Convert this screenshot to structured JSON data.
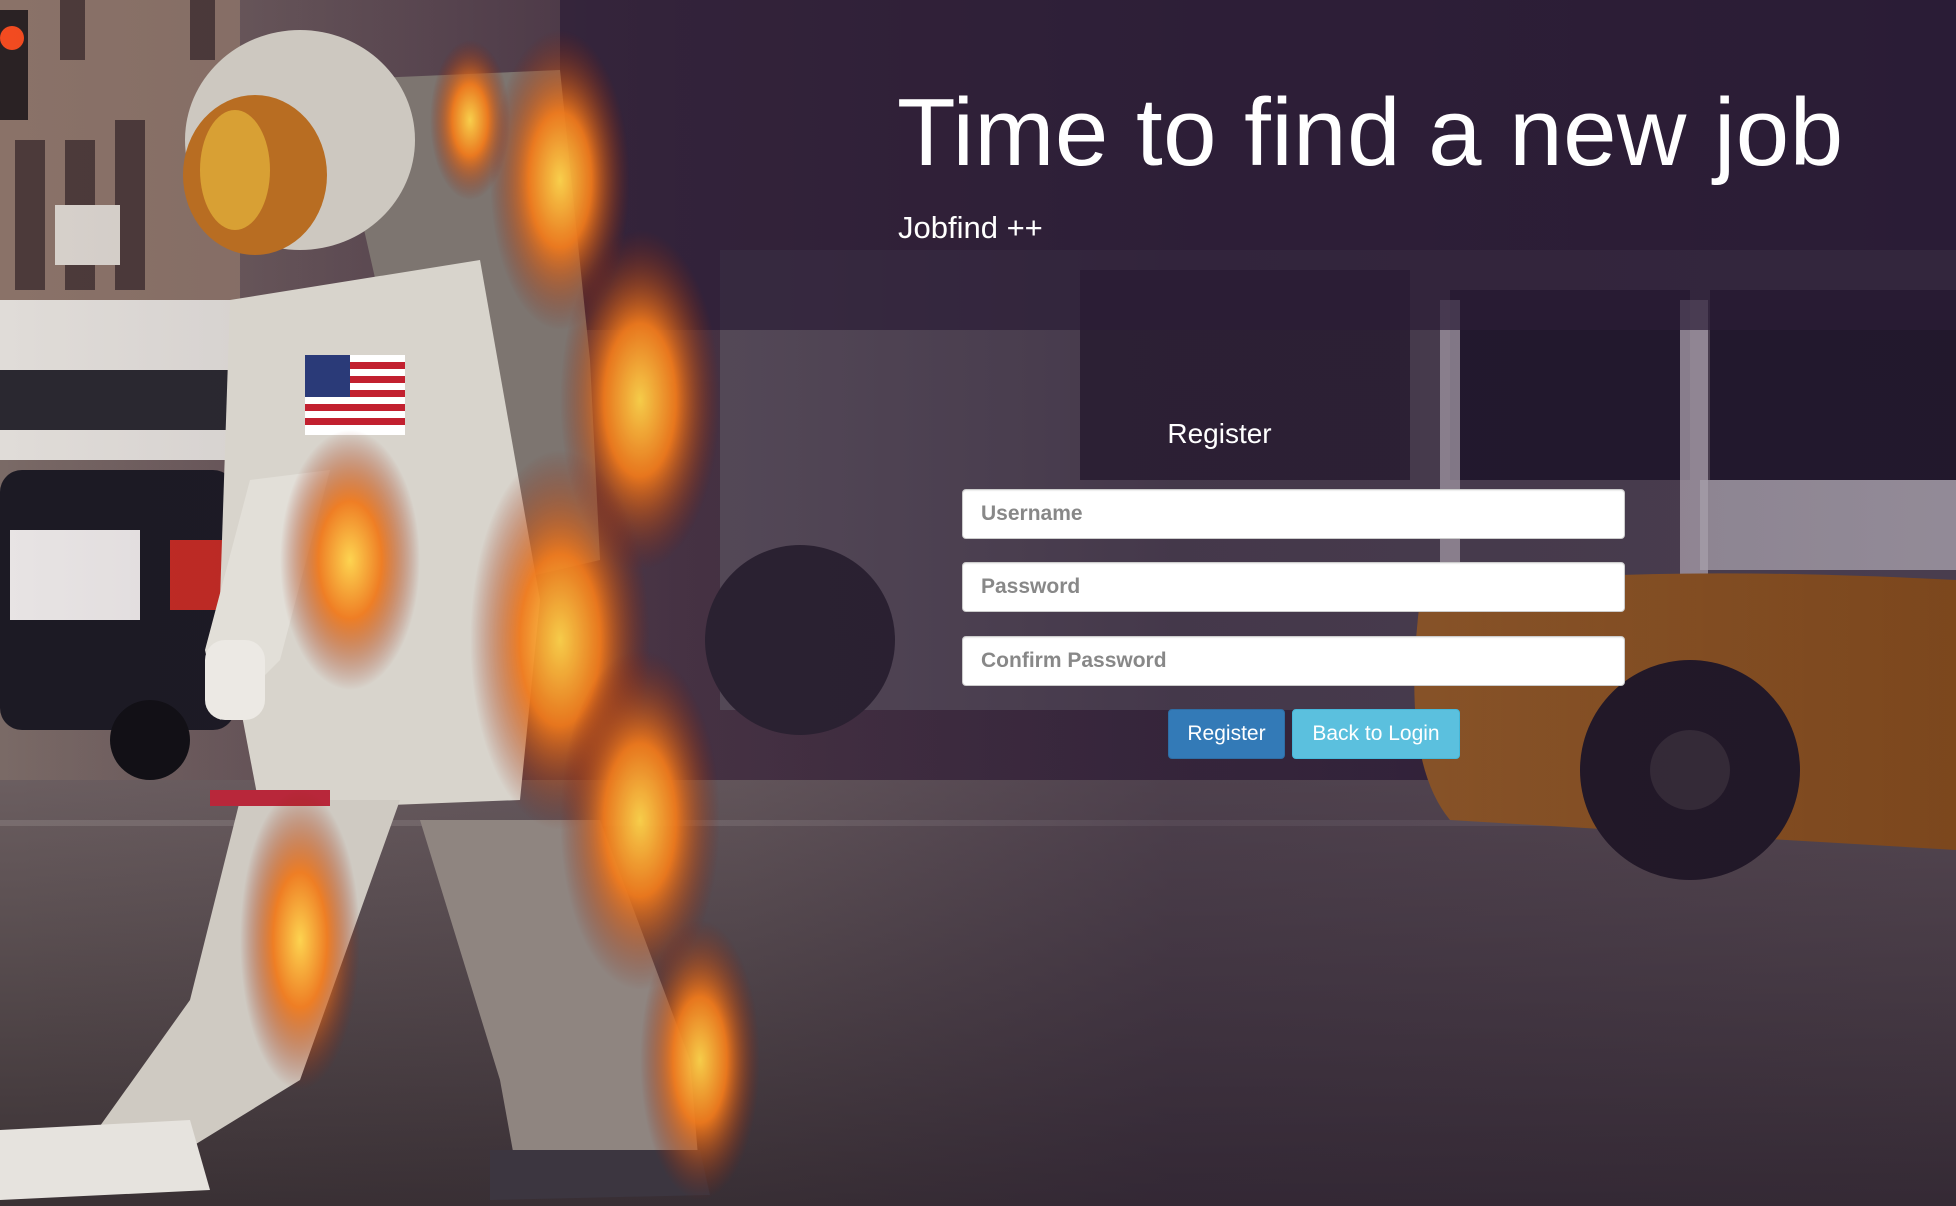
{
  "hero": {
    "title": "Time to find a new job",
    "subtitle": "Jobfind ++"
  },
  "register_form": {
    "heading": "Register",
    "username_placeholder": "Username",
    "password_placeholder": "Password",
    "confirm_placeholder": "Confirm Password",
    "username_value": "",
    "password_value": "",
    "confirm_value": "",
    "register_label": "Register",
    "back_label": "Back to Login"
  },
  "colors": {
    "primary_button": "#337ab7",
    "info_button": "#5bc0de",
    "overlay": "#2f1f3a",
    "text": "#ffffff"
  }
}
